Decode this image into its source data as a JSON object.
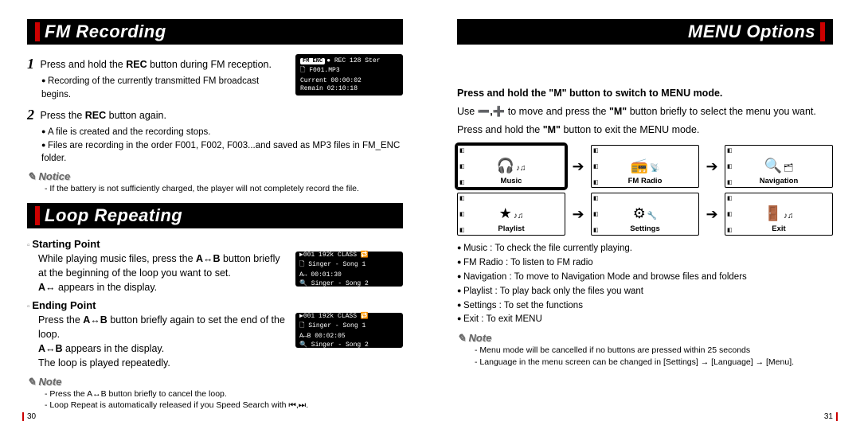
{
  "left": {
    "title1": "FM Recording",
    "step1_num": "1",
    "step1_a": "Press and hold the ",
    "step1_b": "REC",
    "step1_c": " button during FM reception.",
    "step1_sub": "Recording of the currently transmitted FM broadcast begins.",
    "step2_num": "2",
    "step2_a": "Press the ",
    "step2_b": "REC",
    "step2_c": " button again.",
    "step2_sub1": "A file is created and the recording stops.",
    "step2_sub2": "Files are recording in the order F001, F002, F003...and saved as MP3 files in FM_ENC folder.",
    "notice_head": "Notice",
    "notice_line": "If the battery is not sufficiently charged, the player will not completely record the file.",
    "lcd1_tag": "FM ENC",
    "lcd1_rec": "● REC 128 Ster",
    "lcd1_file": "🗋 F001.MP3",
    "lcd1_cur": "Current   00:00:02",
    "lcd1_rem": "Remain    02:10:18",
    "title2": "Loop Repeating",
    "sp_head": "Starting Point",
    "sp_body1a": "While playing music files, press the ",
    "sp_body1b": "A↔B",
    "sp_body1c": " button briefly at the beginning of the loop you want to set.",
    "sp_body2a": "A↔",
    "sp_body2b": " appears in the display.",
    "lcd2a_tags": "▶001 192k CLASS 🔁",
    "lcd2a_l1": "🗋 Singer - Song 1",
    "lcd2a_t": "A↔          00:01:30",
    "lcd2a_l2": "🔍 Singer - Song 2",
    "ep_head": "Ending Point",
    "ep_body1a": "Press the ",
    "ep_body1b": "A↔B",
    "ep_body1c": " button briefly again to set the end of the loop.",
    "ep_body2a": "A↔B",
    "ep_body2b": " appears in the display.",
    "ep_body3": "The loop is played repeatedly.",
    "lcd2b_tags": "▶001 192k CLASS 🔁",
    "lcd2b_l1": "🗋 Singer - Song 1",
    "lcd2b_t": "A↔B         00:02:05",
    "lcd2b_l2": "🔍 Singer - Song 2",
    "note_head": "Note",
    "note1": "Press the A↔B button briefly to cancel the loop.",
    "note2": "Loop Repeat is automatically released if you Speed Search with ⏮,⏭.",
    "page_num": "30"
  },
  "right": {
    "title": "MENU Options",
    "intro1a": "Press and hold the \"M\" button to switch to MENU mode.",
    "intro2a": "Use ",
    "intro2b": "➖,➕",
    "intro2c": " to move and press the ",
    "intro2d": "\"M\"",
    "intro2e": " button briefly to select the menu you want.",
    "intro3a": "Press and hold the ",
    "intro3b": "\"M\"",
    "intro3c": " button to exit the MENU mode.",
    "menu": {
      "music": {
        "icon": "🎧",
        "label": "Music"
      },
      "fmradio": {
        "icon": "📻",
        "label": "FM Radio"
      },
      "navigation": {
        "icon": "🔍",
        "label": "Navigation"
      },
      "playlist": {
        "icon": "★",
        "label": "Playlist"
      },
      "settings": {
        "icon": "⚙",
        "label": "Settings"
      },
      "exit": {
        "icon": "🚪",
        "label": "Exit"
      }
    },
    "arrow": "➔",
    "desc": {
      "music": "Music : To check the file currently playing.",
      "fmradio": "FM Radio : To listen to FM radio",
      "navigation": "Navigation : To move to Navigation Mode and browse files and folders",
      "playlist": "Playlist : To play back only the files you want",
      "settings": "Settings : To set the functions",
      "exit": "Exit : To exit MENU"
    },
    "note_head": "Note",
    "note1": "Menu mode will be cancelled if no buttons are pressed within 25 seconds",
    "note2": "Language in the menu screen can be changed in [Settings] → [Language] → [Menu].",
    "page_num": "31"
  }
}
